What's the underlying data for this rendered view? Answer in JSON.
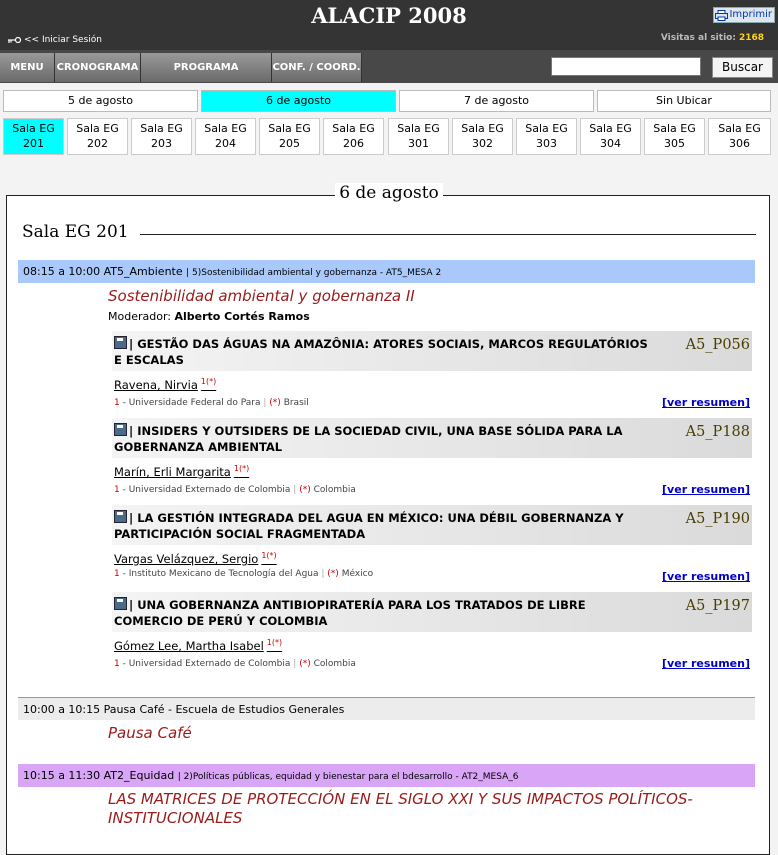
{
  "header": {
    "title": "ALACIP 2008",
    "print_label": "Imprimir",
    "login_label": "<< Iniciar Sesión",
    "visits_label": "Visitas al sitio:",
    "visits_count": "2168"
  },
  "nav": {
    "items": [
      "MENU",
      "CRONOGRAMA",
      "PROGRAMA EXTENDIDO",
      "CONF. / COORD."
    ],
    "search_value": "",
    "search_button": "Buscar"
  },
  "day_tabs": [
    "5 de agosto",
    "6 de agosto",
    "7 de agosto",
    "Sin Ubicar"
  ],
  "active_day": "6 de agosto",
  "room_tabs": [
    [
      "Sala EG",
      "201"
    ],
    [
      "Sala EG",
      "202"
    ],
    [
      "Sala EG",
      "203"
    ],
    [
      "Sala EG",
      "204"
    ],
    [
      "Sala EG",
      "205"
    ],
    [
      "Sala EG",
      "206"
    ],
    [
      "Sala EG",
      "301"
    ],
    [
      "Sala EG",
      "302"
    ],
    [
      "Sala EG",
      "303"
    ],
    [
      "Sala EG",
      "304"
    ],
    [
      "Sala EG",
      "305"
    ],
    [
      "Sala EG",
      "306"
    ]
  ],
  "content": {
    "day_heading": "6 de agosto",
    "room_heading": "Sala EG 201",
    "slots": [
      {
        "time": "08:15 a 10:00 AT5_Ambiente",
        "detail": "| 5)Sostenibilidad ambiental y gobernanza - AT5_MESA 2",
        "color": "#a9c9fd",
        "session_title": "Sostenibilidad ambiental y gobernanza II"
      },
      {
        "time": "10:00 a 10:15 Pausa Café - Escuela de Estudios Generales",
        "detail": "",
        "color": "#ececec",
        "session_title": "Pausa Café"
      },
      {
        "time": "10:15 a 11:30 AT2_Equidad",
        "detail": "| 2)Políticas públicas, equidad y bienestar para el bdesarrollo - AT2_MESA_6",
        "color": "#d9a5f7",
        "session_title": "LAS MATRICES DE PROTECCIÓN EN EL SIGLO XXI Y SUS IMPACTOS POLÍTICOS-INSTITUCIONALES"
      }
    ],
    "moderator_label": "Moderador:",
    "moderator_name": "Alberto Cortés Ramos",
    "papers": [
      {
        "title": "| GESTÃO DAS ÁGUAS NA AMAZÔNIA: ATORES SOCIAIS, MARCOS REGULATÓRIOS E ESCALAS",
        "code": "A5_P056",
        "author": "Ravena, Nirvia",
        "author_sup": "1(*)",
        "affil_num": "1",
        "affil_inst": "- Universidade Federal do Para",
        "affil_star": "(*)",
        "affil_country": "Brasil",
        "resumen": "[ver resumen]"
      },
      {
        "title": "| INSIDERS Y OUTSIDERS DE LA SOCIEDAD CIVIL, UNA BASE SÓLIDA PARA LA GOBERNANZA AMBIENTAL",
        "code": "A5_P188",
        "author": "Marín, Erli Margarita",
        "author_sup": "1(*)",
        "affil_num": "1",
        "affil_inst": "- Universidad Externado de Colombia",
        "affil_star": "(*)",
        "affil_country": "Colombia",
        "resumen": "[ver resumen]"
      },
      {
        "title": "| LA GESTIÓN INTEGRADA DEL AGUA EN MÉXICO: UNA DÉBIL GOBERNANZA Y PARTICIPACIÓN SOCIAL FRAGMENTADA",
        "code": "A5_P190",
        "author": "Vargas Velázquez, Sergio",
        "author_sup": "1(*)",
        "affil_num": "1",
        "affil_inst": "- Instituto Mexicano de Tecnología del Agua",
        "affil_star": "(*)",
        "affil_country": "México",
        "resumen": "[ver resumen]"
      },
      {
        "title": "| UNA GOBERNANZA ANTIBIOPIRATERÍA PARA LOS TRATADOS DE LIBRE COMERCIO DE PERÚ Y COLOMBIA",
        "code": "A5_P197",
        "author": "Gómez Lee, Martha Isabel",
        "author_sup": "1(*)",
        "affil_num": "1",
        "affil_inst": "- Universidad Externado de Colombia",
        "affil_star": "(*)",
        "affil_country": "Colombia",
        "resumen": "[ver resumen]"
      }
    ]
  }
}
